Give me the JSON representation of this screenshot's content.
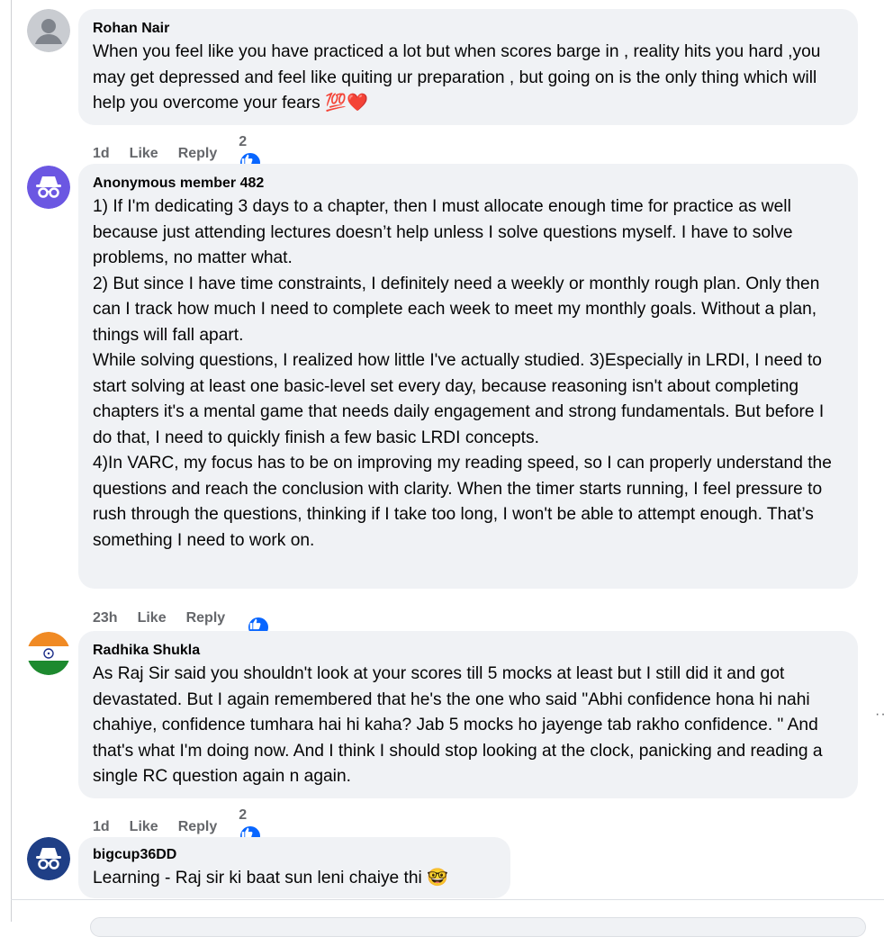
{
  "comments": [
    {
      "author": "Rohan Nair",
      "text": "When you feel like you have practiced a lot but when scores barge in , reality hits you hard ,you may get depressed and feel like quiting ur preparation , but going on is the only thing which will help you overcome your fears 💯❤️",
      "time": "1d",
      "like_label": "Like",
      "reply_label": "Reply",
      "reaction_count": "2",
      "avatar_icon": "default-user-icon"
    },
    {
      "author": "Anonymous member 482",
      "text": "1) If I'm dedicating 3 days to a chapter, then I must allocate enough time for practice as well because just attending lectures doesn’t help unless I solve questions myself. I have to solve problems, no matter what.\n2) But since I have time constraints, I definitely need a weekly or monthly rough plan. Only then can I track how much I need to complete each week to meet my monthly goals. Without a plan, things will fall apart.\nWhile solving questions, I realized how little I've actually studied. 3)Especially in LRDI, I need to start solving at least one basic-level set every day, because reasoning isn't about completing chapters it's a mental game that needs daily engagement and strong fundamentals. But before I do that, I need to quickly finish a few basic LRDI concepts.\n4)In VARC, my focus has to be on improving my reading speed, so I can properly understand the questions and reach the conclusion with clarity. When the timer starts running, I feel pressure to rush through the questions, thinking if I take too long, I won't be able to attempt enough. That’s something I need to work on.",
      "time": "23h",
      "like_label": "Like",
      "reply_label": "Reply",
      "reaction_count": "",
      "avatar_icon": "anonymous-incognito-icon"
    },
    {
      "author": "Radhika Shukla",
      "text": "As Raj Sir said you shouldn't look at your scores till 5 mocks at least but I still did it and got devastated. But I again remembered that he's the one who said \"Abhi confidence hona hi nahi chahiye, confidence tumhara hai hi kaha? Jab 5 mocks ho jayenge tab rakho confidence. \" And that's what I'm doing now. And I think I should stop looking at the clock, panicking and reading a single RC question again n again.",
      "time": "1d",
      "like_label": "Like",
      "reply_label": "Reply",
      "reaction_count": "2",
      "avatar_icon": "india-flag-icon"
    },
    {
      "author": "bigcup36DD",
      "text": "Learning - Raj sir ki baat sun leni chaiye thi 🤓",
      "time": "",
      "like_label": "",
      "reply_label": "",
      "reaction_count": "",
      "avatar_icon": "anonymous-incognito-icon"
    }
  ],
  "colors": {
    "bubble_bg": "#f0f2f5",
    "like_blue": "#0866ff",
    "anon_purple": "#6b57e2",
    "anon_navy": "#1f3f86",
    "meta_gray": "#65676b"
  },
  "more_icon": "more-options-icon"
}
